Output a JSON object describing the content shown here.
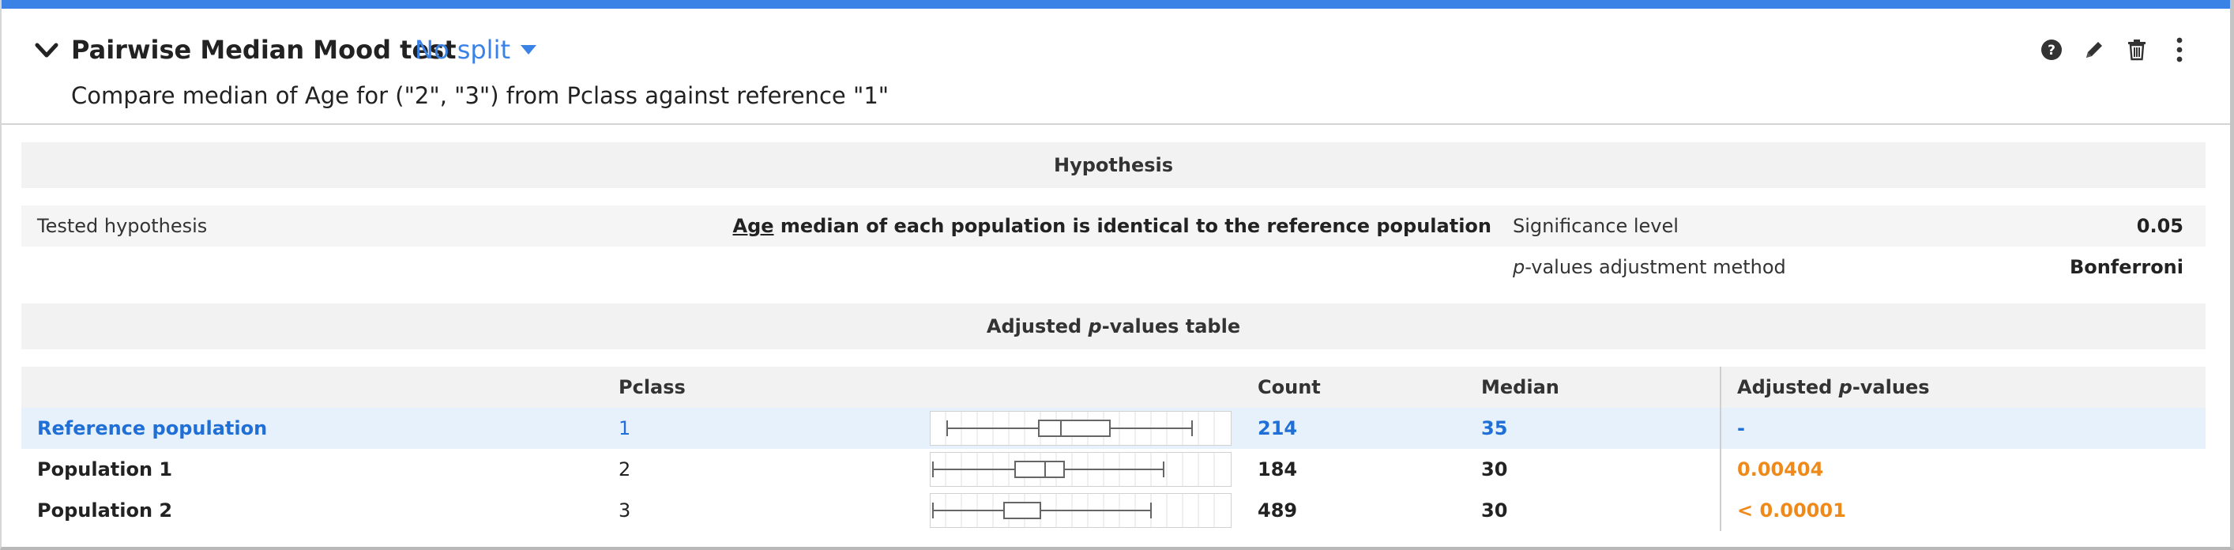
{
  "card": {
    "title": "Pairwise Median Mood test",
    "split_label": "No split",
    "subtitle": "Compare median of Age for (\"2\", \"3\") from Pclass against reference \"1\"",
    "icons": [
      "chevron-down-icon",
      "help-icon",
      "pencil-icon",
      "trash-icon",
      "more-vertical-icon"
    ]
  },
  "hypothesis": {
    "section_title": "Hypothesis",
    "tested_label": "Tested hypothesis",
    "tested_variable": "Age",
    "tested_text": " median of each population is identical to the reference population",
    "significance_label": "Significance level",
    "significance_value": "0.05",
    "adjustment_label_p": "p",
    "adjustment_label_rest": "-values adjustment method",
    "adjustment_value": "Bonferroni"
  },
  "adjusted": {
    "section_title_pre": "Adjusted ",
    "section_title_p": "p",
    "section_title_post": "-values table",
    "columns": {
      "pclass": "Pclass",
      "count": "Count",
      "median": "Median",
      "adj_pre": "Adjusted ",
      "adj_p": "p",
      "adj_post": "-values"
    },
    "rows": [
      {
        "name": "Reference population",
        "pclass": "1",
        "count": "214",
        "median": "35",
        "adjusted": "-"
      },
      {
        "name": "Population 1",
        "pclass": "2",
        "count": "184",
        "median": "30",
        "adjusted": "0.00404"
      },
      {
        "name": "Population 2",
        "pclass": "3",
        "count": "489",
        "median": "30",
        "adjusted": "< 0.00001"
      }
    ]
  },
  "colors": {
    "accent": "#3b82e6",
    "reference_text": "#1f6fd6",
    "pvalue_text": "#ef8a1a",
    "reference_row_bg": "#e7f1fc"
  }
}
